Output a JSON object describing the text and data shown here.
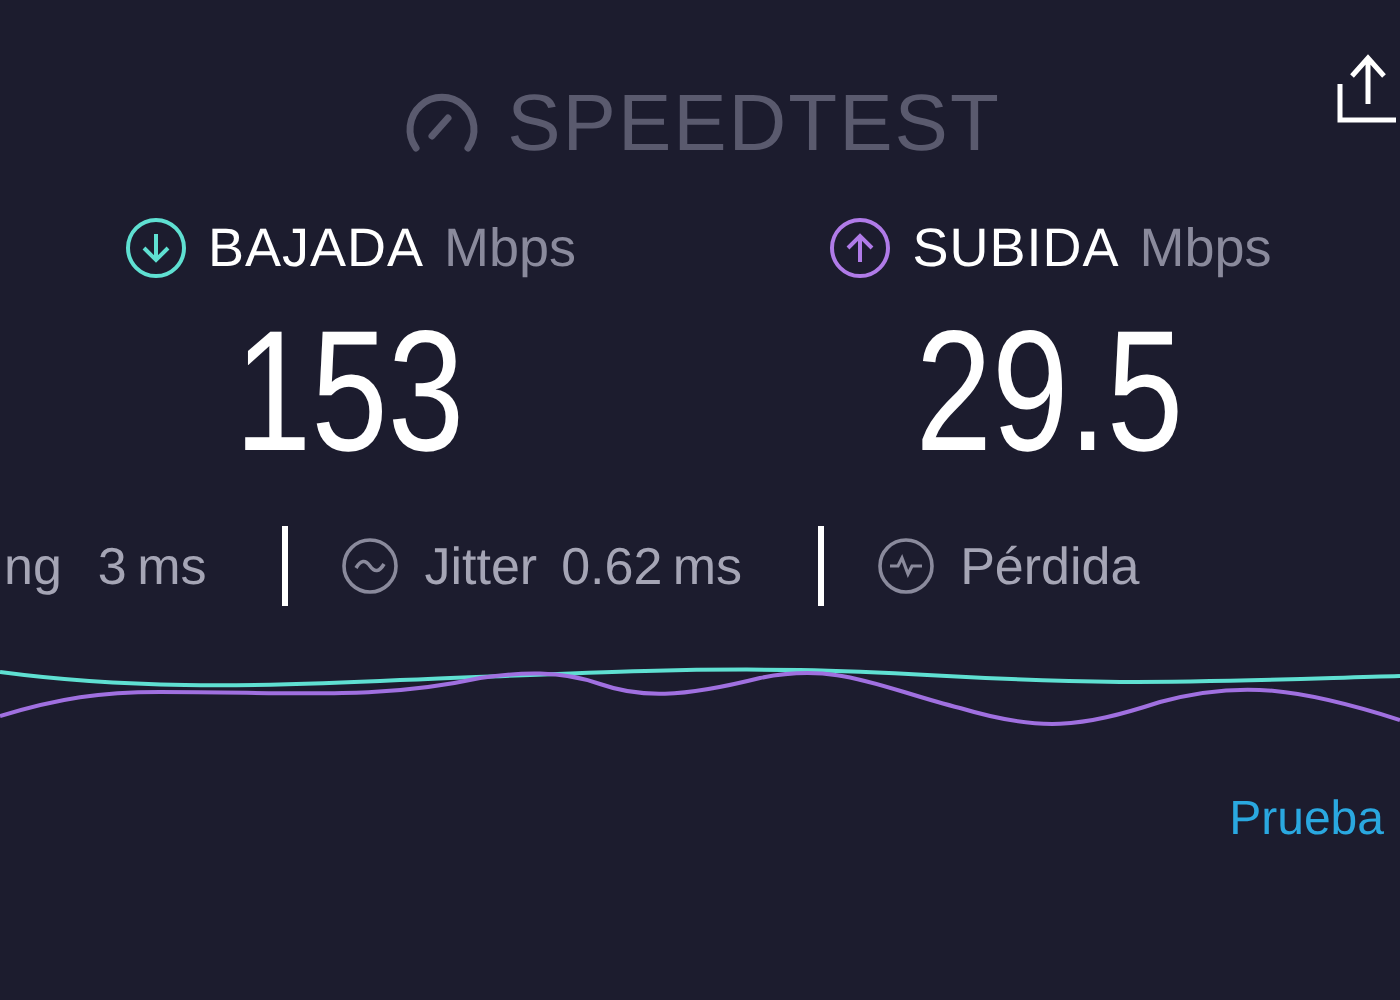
{
  "header": {
    "logo_text": "SPEEDTEST"
  },
  "results": [
    {
      "kind": "download",
      "label": "BAJADA",
      "unit": "Mbps",
      "value": "153",
      "color": "#5fe0d2"
    },
    {
      "kind": "upload",
      "label": "SUBIDA",
      "unit": "Mbps",
      "value": "29.5",
      "color": "#b07be8"
    }
  ],
  "metrics": [
    {
      "kind": "ping",
      "label": "ng",
      "value": "3",
      "unit": "ms"
    },
    {
      "kind": "jitter",
      "label": "Jitter",
      "value": "0.62",
      "unit": "ms"
    },
    {
      "kind": "loss",
      "label": "Pérdida"
    }
  ],
  "footer_link": "Prueba"
}
